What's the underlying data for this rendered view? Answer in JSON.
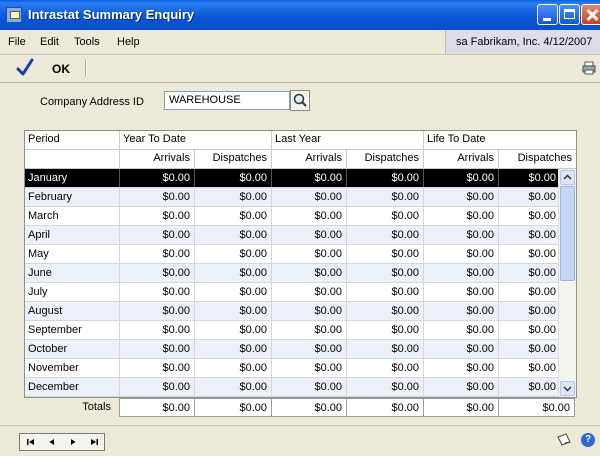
{
  "window": {
    "title": "Intrastat Summary Enquiry"
  },
  "menu": {
    "file": "File",
    "edit": "Edit",
    "tools": "Tools",
    "help": "Help"
  },
  "user_info": "sa  Fabrikam, Inc.  4/12/2007",
  "toolbar": {
    "ok_label": "OK"
  },
  "form": {
    "company_label": "Company Address ID",
    "company_value": "WAREHOUSE"
  },
  "grid": {
    "group_headers": {
      "period": "Period",
      "ytd": "Year To Date",
      "last_year": "Last Year",
      "ltd": "Life To Date"
    },
    "sub_headers": {
      "arrivals": "Arrivals",
      "dispatches": "Dispatches"
    },
    "rows": [
      {
        "period": "January",
        "values": [
          "$0.00",
          "$0.00",
          "$0.00",
          "$0.00",
          "$0.00",
          "$0.00"
        ]
      },
      {
        "period": "February",
        "values": [
          "$0.00",
          "$0.00",
          "$0.00",
          "$0.00",
          "$0.00",
          "$0.00"
        ]
      },
      {
        "period": "March",
        "values": [
          "$0.00",
          "$0.00",
          "$0.00",
          "$0.00",
          "$0.00",
          "$0.00"
        ]
      },
      {
        "period": "April",
        "values": [
          "$0.00",
          "$0.00",
          "$0.00",
          "$0.00",
          "$0.00",
          "$0.00"
        ]
      },
      {
        "period": "May",
        "values": [
          "$0.00",
          "$0.00",
          "$0.00",
          "$0.00",
          "$0.00",
          "$0.00"
        ]
      },
      {
        "period": "June",
        "values": [
          "$0.00",
          "$0.00",
          "$0.00",
          "$0.00",
          "$0.00",
          "$0.00"
        ]
      },
      {
        "period": "July",
        "values": [
          "$0.00",
          "$0.00",
          "$0.00",
          "$0.00",
          "$0.00",
          "$0.00"
        ]
      },
      {
        "period": "August",
        "values": [
          "$0.00",
          "$0.00",
          "$0.00",
          "$0.00",
          "$0.00",
          "$0.00"
        ]
      },
      {
        "period": "September",
        "values": [
          "$0.00",
          "$0.00",
          "$0.00",
          "$0.00",
          "$0.00",
          "$0.00"
        ]
      },
      {
        "period": "October",
        "values": [
          "$0.00",
          "$0.00",
          "$0.00",
          "$0.00",
          "$0.00",
          "$0.00"
        ]
      },
      {
        "period": "November",
        "values": [
          "$0.00",
          "$0.00",
          "$0.00",
          "$0.00",
          "$0.00",
          "$0.00"
        ]
      },
      {
        "period": "December",
        "values": [
          "$0.00",
          "$0.00",
          "$0.00",
          "$0.00",
          "$0.00",
          "$0.00"
        ]
      }
    ],
    "totals_label": "Totals",
    "totals": [
      "$0.00",
      "$0.00",
      "$0.00",
      "$0.00",
      "$0.00",
      "$0.00"
    ]
  },
  "colors": {
    "title_bar": "#0b58d8",
    "selected_row": "#000000",
    "alt_row": "#ecf0f8",
    "dialog_bg": "#ece9d8"
  },
  "icons": [
    "app-icon",
    "minimize-icon",
    "maximize-icon",
    "close-icon",
    "ok-check-icon",
    "print-icon",
    "lookup-icon",
    "first-record-icon",
    "previous-record-icon",
    "next-record-icon",
    "last-record-icon",
    "note-icon",
    "help-icon"
  ]
}
